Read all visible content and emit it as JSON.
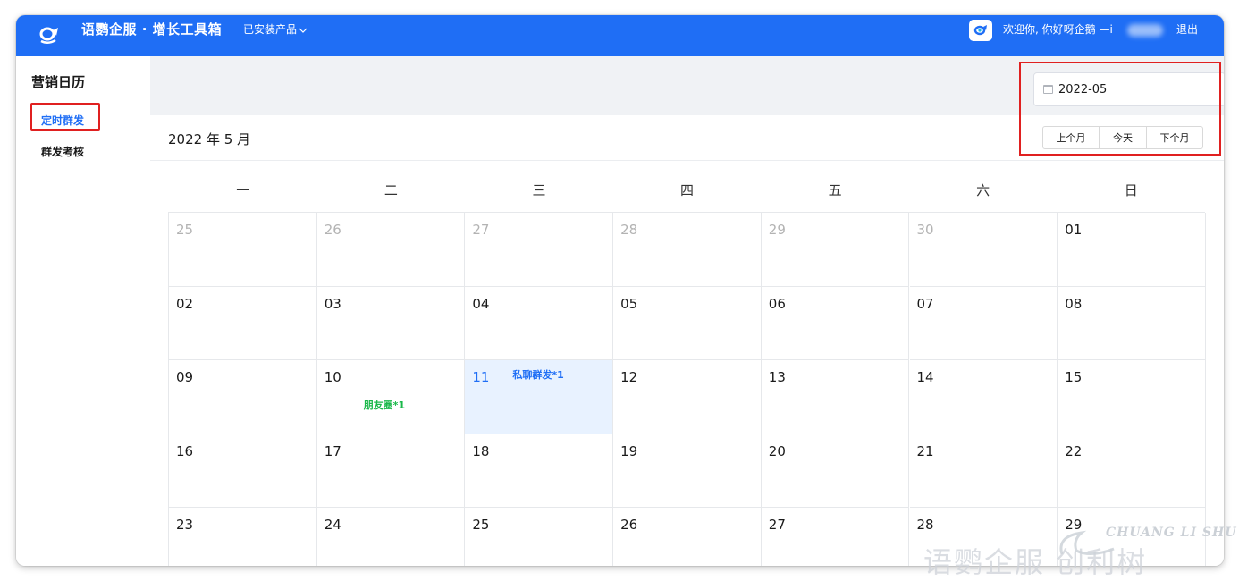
{
  "header": {
    "brand": "语鹦企服 · 增长工具箱",
    "installed_label": "已安装产品",
    "welcome": "欢迎你, 你好呀企鹅 —i",
    "logout": "退出"
  },
  "sidebar": {
    "title": "营销日历",
    "items": [
      {
        "label": "定时群发",
        "active": true
      },
      {
        "label": "群发考核",
        "active": false
      }
    ]
  },
  "calendar": {
    "title": "2022 年 5 月",
    "month_picker_value": "2022-05",
    "buttons": {
      "prev": "上个月",
      "today": "今天",
      "next": "下个月"
    },
    "weekdays": [
      "一",
      "二",
      "三",
      "四",
      "五",
      "六",
      "日"
    ],
    "weeks": [
      [
        {
          "d": "25",
          "muted": true
        },
        {
          "d": "26",
          "muted": true
        },
        {
          "d": "27",
          "muted": true
        },
        {
          "d": "28",
          "muted": true
        },
        {
          "d": "29",
          "muted": true
        },
        {
          "d": "30",
          "muted": true
        },
        {
          "d": "01"
        }
      ],
      [
        {
          "d": "02"
        },
        {
          "d": "03"
        },
        {
          "d": "04"
        },
        {
          "d": "05"
        },
        {
          "d": "06"
        },
        {
          "d": "07"
        },
        {
          "d": "08"
        }
      ],
      [
        {
          "d": "09"
        },
        {
          "d": "10",
          "event": "朋友圈*1",
          "event_color": "green"
        },
        {
          "d": "11",
          "today": true,
          "event": "私聊群发*1",
          "event_color": "blue"
        },
        {
          "d": "12"
        },
        {
          "d": "13"
        },
        {
          "d": "14"
        },
        {
          "d": "15"
        }
      ],
      [
        {
          "d": "16"
        },
        {
          "d": "17"
        },
        {
          "d": "18"
        },
        {
          "d": "19"
        },
        {
          "d": "20"
        },
        {
          "d": "21"
        },
        {
          "d": "22"
        }
      ],
      [
        {
          "d": "23"
        },
        {
          "d": "24"
        },
        {
          "d": "25"
        },
        {
          "d": "26"
        },
        {
          "d": "27"
        },
        {
          "d": "28"
        },
        {
          "d": "29"
        }
      ]
    ]
  },
  "watermark": {
    "en": "CHUANG LI SHU",
    "cn": "语鹦企服 创利树"
  },
  "colors": {
    "header": "#1f6ef5",
    "accent": "#1f6ef5",
    "today_bg": "#e8f2ff",
    "event_green": "#1ab84a",
    "highlight_border": "#e02020"
  }
}
